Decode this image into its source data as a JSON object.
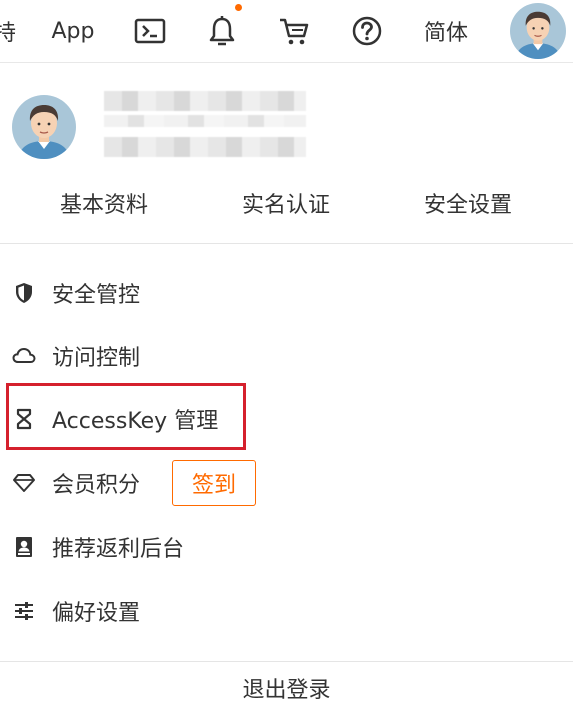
{
  "topbar": {
    "cut_text": "持",
    "app_label": "App",
    "icons": {
      "terminal": "terminal-icon",
      "bell": "bell-icon",
      "cart": "cart-icon",
      "help": "help-icon"
    },
    "bell_dot_color": "#ff6a00",
    "language_label": "简体"
  },
  "profile": {
    "tabs": [
      "基本资料",
      "实名认证",
      "安全设置"
    ]
  },
  "menu": {
    "items": [
      {
        "label": "安全管控",
        "icon": "shield-icon"
      },
      {
        "label": "访问控制",
        "icon": "cloud-icon"
      },
      {
        "label": "AccessKey 管理",
        "icon": "key-bracket-icon"
      },
      {
        "label": "会员积分",
        "icon": "diamond-icon"
      },
      {
        "label": "推荐返利后台",
        "icon": "portrait-card-icon"
      },
      {
        "label": "偏好设置",
        "icon": "sliders-icon"
      }
    ],
    "signin_label": "签到"
  },
  "logout_label": "退出登录",
  "colors": {
    "accent": "#ff6a00",
    "highlight": "#d5202d",
    "text": "#333333"
  }
}
